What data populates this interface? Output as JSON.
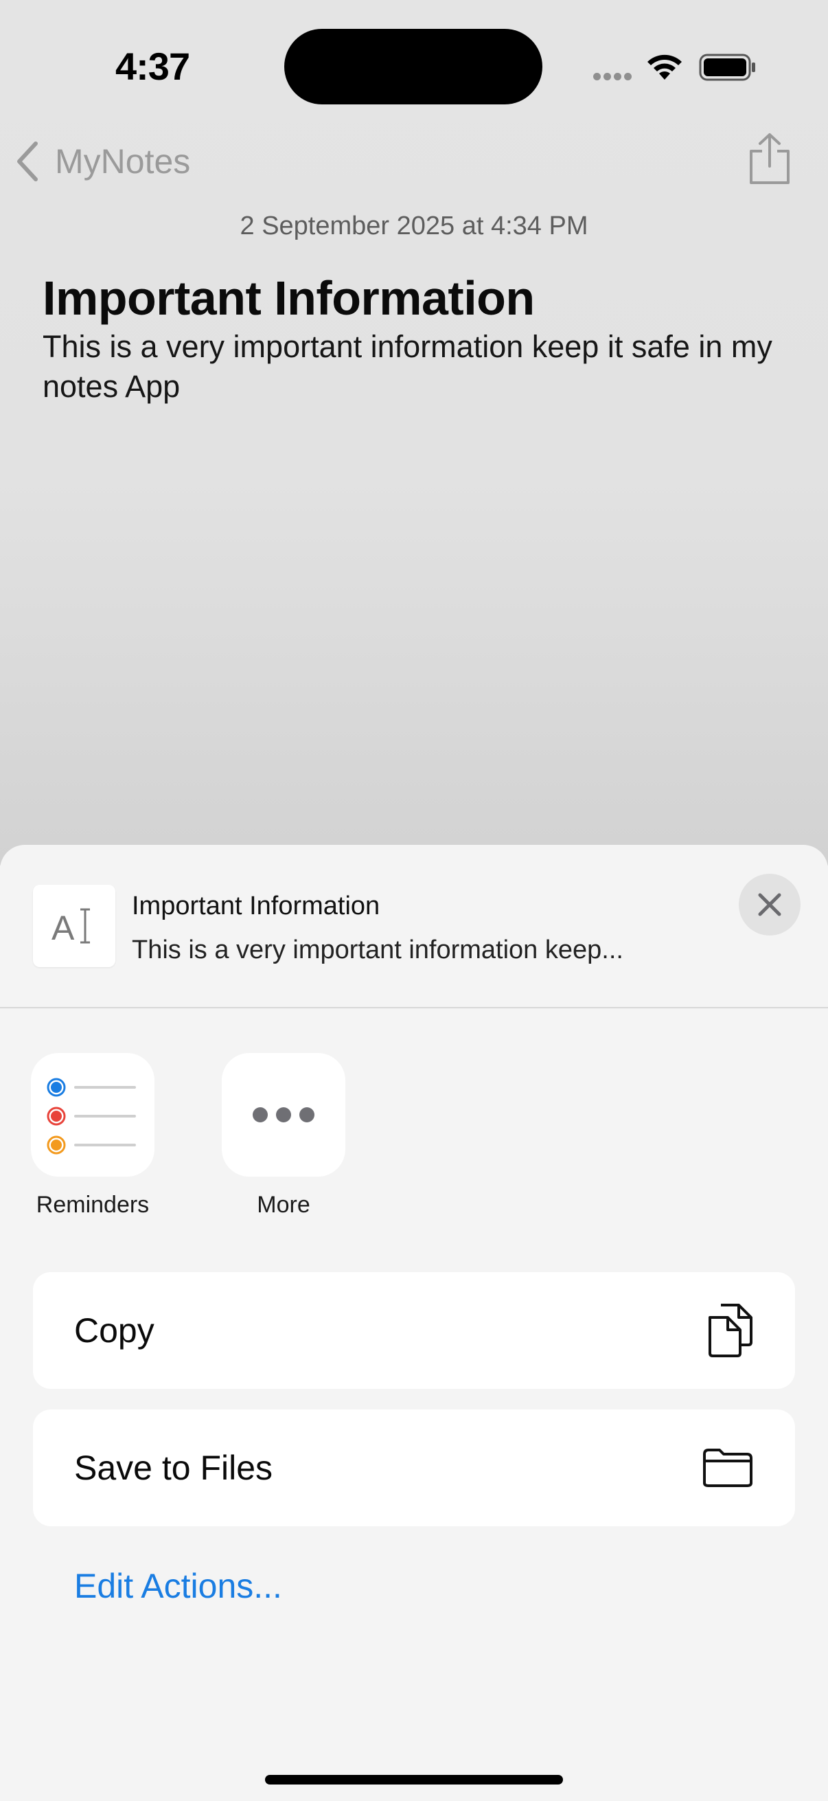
{
  "status_bar": {
    "time": "4:37"
  },
  "nav": {
    "back_label": "MyNotes"
  },
  "note": {
    "date": "2 September 2025 at 4:34 PM",
    "title": "Important Information",
    "body": "This is a very important information keep it safe in my notes App"
  },
  "share_sheet": {
    "preview_title": "Important Information",
    "preview_subtitle": "This is a very important information keep...",
    "apps": [
      {
        "label": "Reminders",
        "icon": "reminders-icon"
      },
      {
        "label": "More",
        "icon": "more-icon"
      }
    ],
    "actions": [
      {
        "label": "Copy",
        "icon": "copy-icon"
      },
      {
        "label": "Save to Files",
        "icon": "folder-icon"
      }
    ],
    "edit_actions_label": "Edit Actions...",
    "colors": {
      "link": "#1a7de2",
      "reminder_blue": "#1a7de2",
      "reminder_red": "#e8433a",
      "reminder_orange": "#f39a1e"
    }
  }
}
